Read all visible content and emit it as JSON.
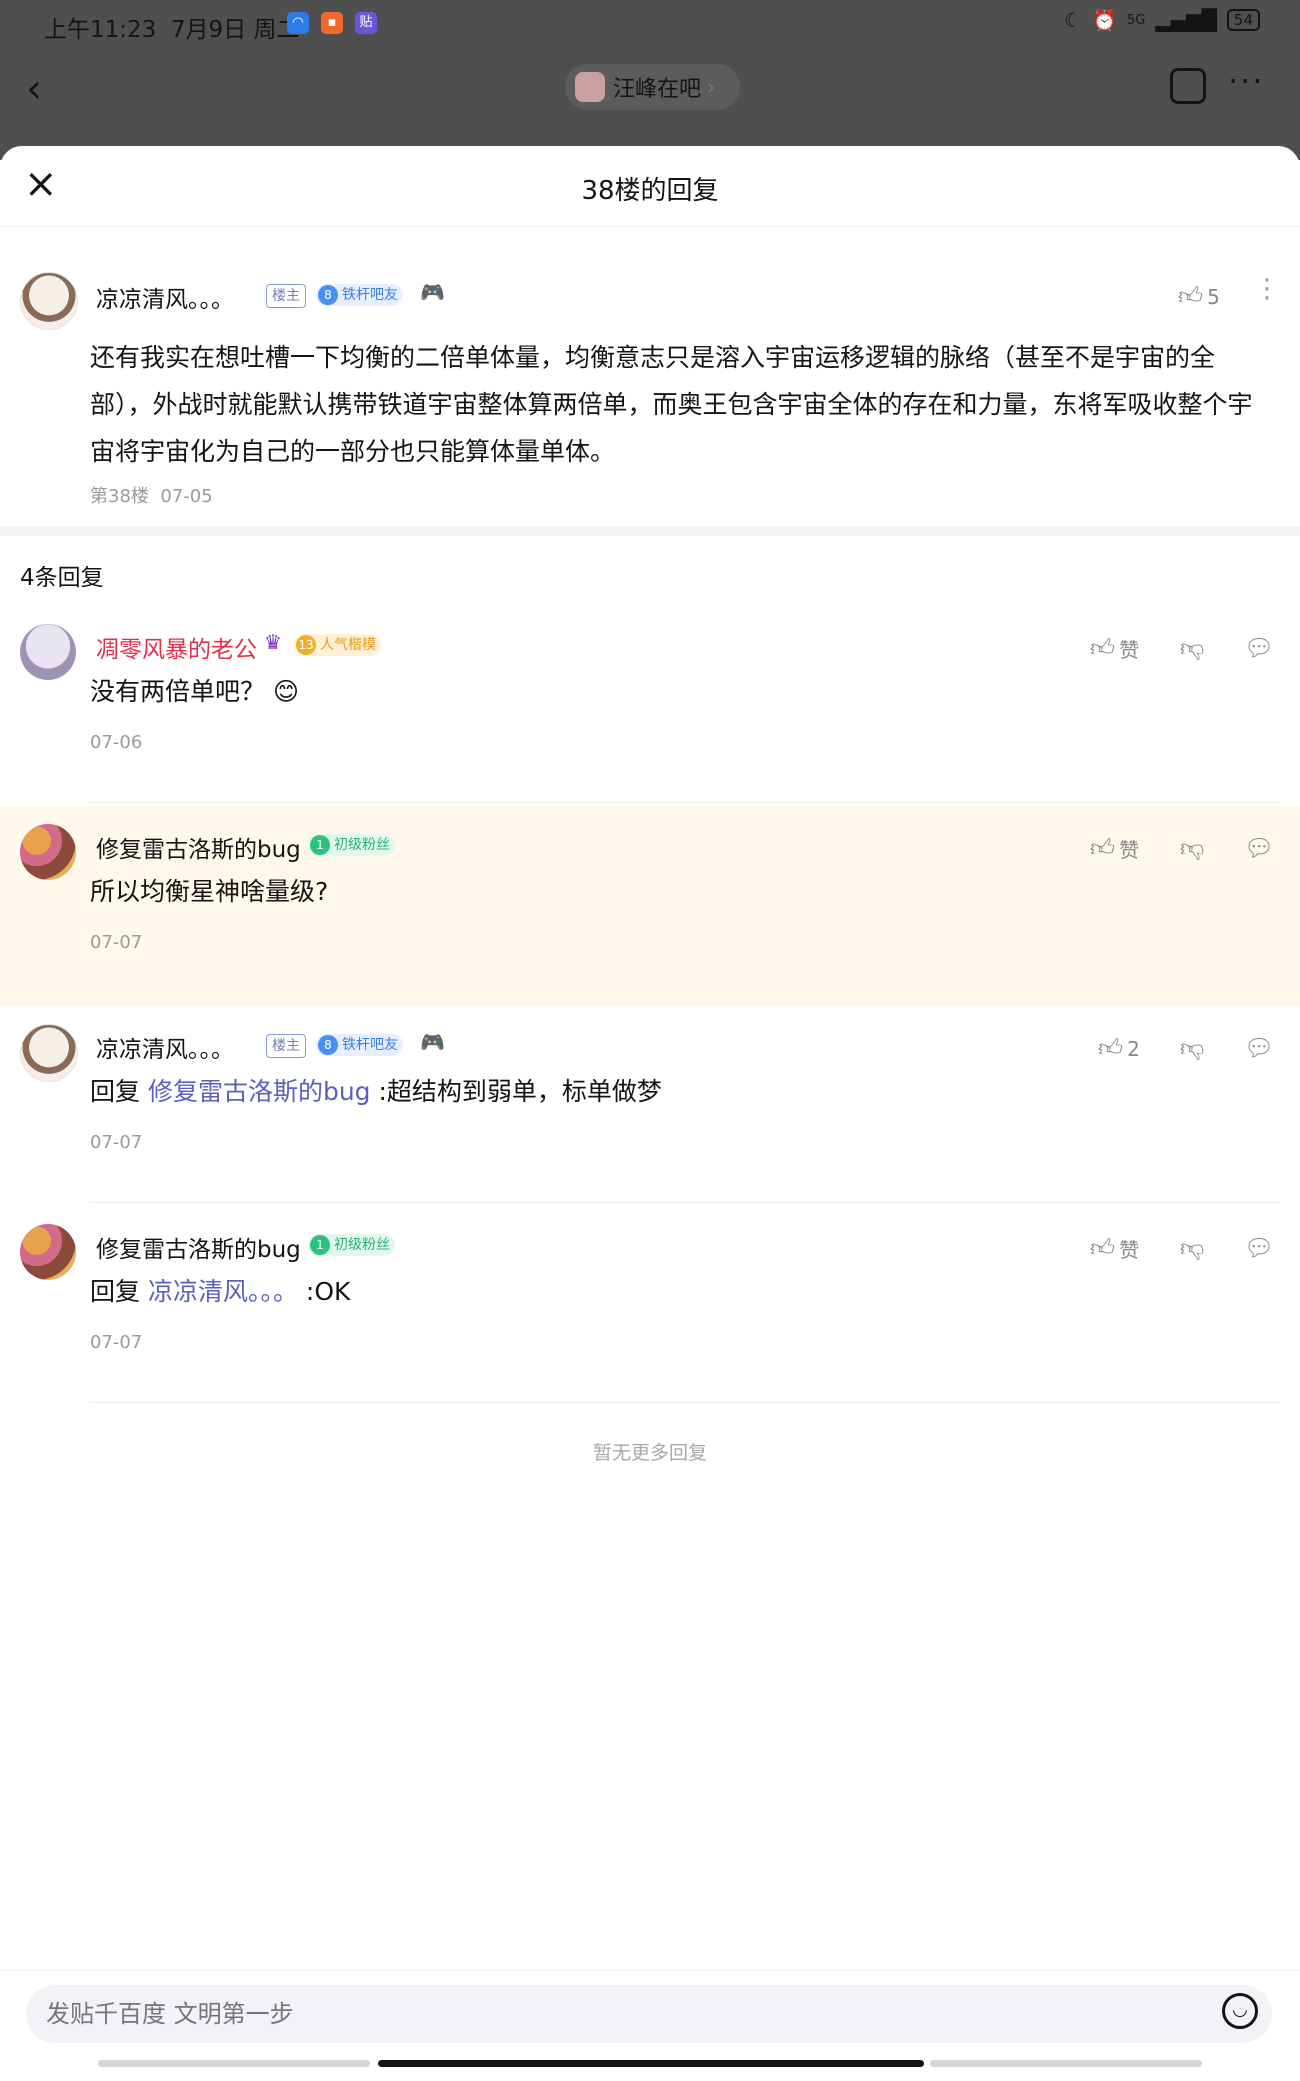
{
  "status_bar": {
    "time": "上午11:23",
    "date": "7月9日",
    "weekday": "周二",
    "app_icons": [
      "blue-app-icon",
      "orange-video-icon",
      "purple-tieba-icon"
    ],
    "tieba_app_label": "贴",
    "network": "5G",
    "battery": "54"
  },
  "nav": {
    "forum_name": "汪峰在吧",
    "forum_arrow": "›"
  },
  "sheet": {
    "title": "38楼的回复",
    "close_label": "×"
  },
  "main_post": {
    "author": "凉凉清风。。。",
    "host_badge": "楼主",
    "level": "8",
    "level_title": "铁杆吧友",
    "like_count": "5",
    "content": "还有我实在想吐槽一下均衡的二倍单体量，均衡意志只是溶入宇宙运移逻辑的脉络（甚至不是宇宙的全部），外战时就能默认携带铁道宇宙整体算两倍单，而奥王包含宇宙全体的存在和力量，东将军吸收整个宇宙将宇宙化为自己的一部分也只能算体量单体。",
    "floor": "第38楼",
    "date": "07-05"
  },
  "reply_count": "4条回复",
  "replies": [
    {
      "author": "凋零风暴的老公",
      "level": "13",
      "level_title": "人气楷模",
      "content": "没有两倍单吧？",
      "date": "07-06",
      "like": "赞"
    },
    {
      "author": "修复雷古洛斯的bug",
      "level": "1",
      "level_title": "初级粉丝",
      "content": "所以均衡星神啥量级?",
      "date": "07-07",
      "like": "赞"
    },
    {
      "author": "凉凉清风。。。",
      "host_badge": "楼主",
      "level": "8",
      "level_title": "铁杆吧友",
      "reply_prefix": "回复 ",
      "reply_to": "修复雷古洛斯的bug",
      "content": " :超结构到弱单，标单做梦",
      "date": "07-07",
      "like": "2"
    },
    {
      "author": "修复雷古洛斯的bug",
      "level": "1",
      "level_title": "初级粉丝",
      "reply_prefix": "回复 ",
      "reply_to": "凉凉清风。。。",
      "content": " :OK",
      "date": "07-07",
      "like": "赞"
    }
  ],
  "no_more_text": "暂无更多回复",
  "input": {
    "placeholder": "发贴千百度 文明第一步"
  },
  "colors": {
    "accent_link": "#5a5fc0",
    "highlight_row": "#fdf8ea",
    "vip_name": "#e0304a"
  }
}
